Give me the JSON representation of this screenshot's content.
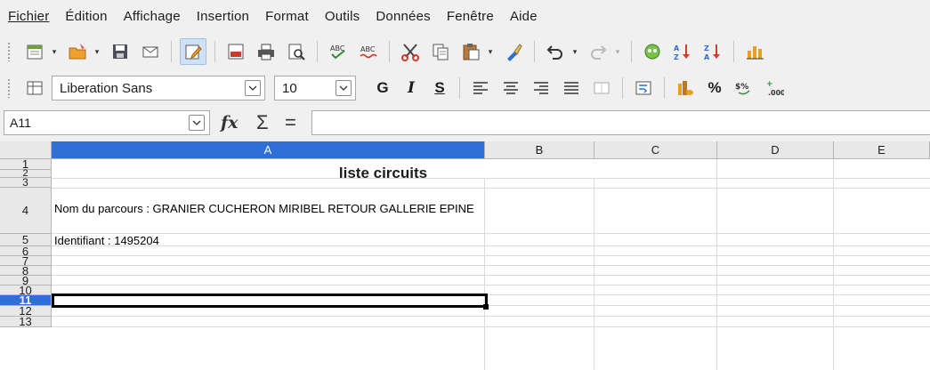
{
  "menu": {
    "items": [
      {
        "label": "Fichier"
      },
      {
        "label": "Édition"
      },
      {
        "label": "Affichage"
      },
      {
        "label": "Insertion"
      },
      {
        "label": "Format"
      },
      {
        "label": "Outils"
      },
      {
        "label": "Données"
      },
      {
        "label": "Fenêtre"
      },
      {
        "label": "Aide"
      }
    ]
  },
  "toolbar": {
    "font_name": "Liberation Sans",
    "font_size": "10",
    "bold_label": "G",
    "italic_label": "I",
    "underline_label": "S",
    "percent_label": "%"
  },
  "formula_bar": {
    "cell_ref": "A11",
    "fx_label": "fx",
    "sigma_label": "Σ",
    "equals_label": "=",
    "formula": ""
  },
  "sheet": {
    "columns": [
      "A",
      "B",
      "C",
      "D",
      "E"
    ],
    "active_column": "A",
    "rows": [
      "1",
      "2",
      "3",
      "4",
      "5",
      "6",
      "7",
      "8",
      "9",
      "10",
      "11",
      "12",
      "13"
    ],
    "active_row": "11",
    "title": "liste circuits",
    "parcours": "Nom du parcours : GRANIER CUCHERON MIRIBEL RETOUR GALLERIE EPINE",
    "identifiant": "Identifiant : 1495204"
  },
  "colors": {
    "accent": "#2e6fd8",
    "header_bg": "#e8e8e8",
    "selected_tool": "#cfe2f5"
  }
}
